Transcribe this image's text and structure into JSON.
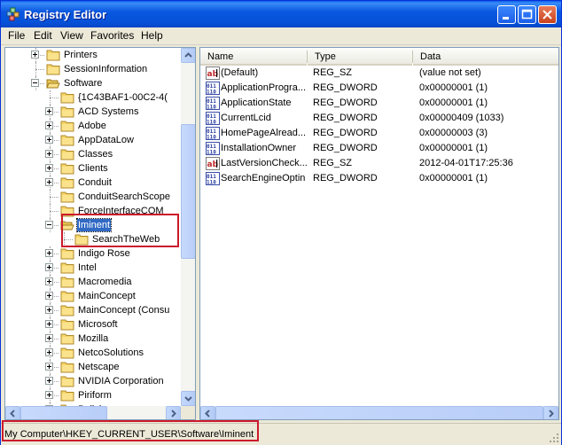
{
  "window": {
    "title": "Registry Editor"
  },
  "menu": [
    "File",
    "Edit",
    "View",
    "Favorites",
    "Help"
  ],
  "tree": {
    "items": [
      {
        "label": "Printers",
        "level": 3,
        "expander": "plus"
      },
      {
        "label": "SessionInformation",
        "level": 3,
        "expander": "none"
      },
      {
        "label": "Software",
        "level": 3,
        "expander": "minus",
        "open": true
      },
      {
        "label": "{1C43BAF1-00C2-4(",
        "level": 4,
        "expander": "none"
      },
      {
        "label": "ACD Systems",
        "level": 4,
        "expander": "plus"
      },
      {
        "label": "Adobe",
        "level": 4,
        "expander": "plus"
      },
      {
        "label": "AppDataLow",
        "level": 4,
        "expander": "plus"
      },
      {
        "label": "Classes",
        "level": 4,
        "expander": "plus"
      },
      {
        "label": "Clients",
        "level": 4,
        "expander": "plus"
      },
      {
        "label": "Conduit",
        "level": 4,
        "expander": "plus"
      },
      {
        "label": "ConduitSearchScope",
        "level": 4,
        "expander": "none"
      },
      {
        "label": "ForceInterfaceCOM",
        "level": 4,
        "expander": "none"
      },
      {
        "label": "Iminent",
        "level": 4,
        "expander": "minus",
        "open": true,
        "selected": true
      },
      {
        "label": "SearchTheWeb",
        "level": 5,
        "expander": "none"
      },
      {
        "label": "Indigo Rose",
        "level": 4,
        "expander": "plus"
      },
      {
        "label": "Intel",
        "level": 4,
        "expander": "plus"
      },
      {
        "label": "Macromedia",
        "level": 4,
        "expander": "plus"
      },
      {
        "label": "MainConcept",
        "level": 4,
        "expander": "plus"
      },
      {
        "label": "MainConcept (Consu",
        "level": 4,
        "expander": "plus"
      },
      {
        "label": "Microsoft",
        "level": 4,
        "expander": "plus"
      },
      {
        "label": "Mozilla",
        "level": 4,
        "expander": "plus"
      },
      {
        "label": "NetcoSolutions",
        "level": 4,
        "expander": "plus"
      },
      {
        "label": "Netscape",
        "level": 4,
        "expander": "plus"
      },
      {
        "label": "NVIDIA Corporation",
        "level": 4,
        "expander": "plus"
      },
      {
        "label": "Piriform",
        "level": 4,
        "expander": "plus"
      },
      {
        "label": "Policies",
        "level": 4,
        "expander": "plus"
      }
    ]
  },
  "list": {
    "columns": [
      "Name",
      "Type",
      "Data"
    ],
    "rows": [
      {
        "icon": "string-value-icon",
        "name": "(Default)",
        "type": "REG_SZ",
        "data": "(value not set)"
      },
      {
        "icon": "binary-value-icon",
        "name": "ApplicationProgra...",
        "type": "REG_DWORD",
        "data": "0x00000001 (1)"
      },
      {
        "icon": "binary-value-icon",
        "name": "ApplicationState",
        "type": "REG_DWORD",
        "data": "0x00000001 (1)"
      },
      {
        "icon": "binary-value-icon",
        "name": "CurrentLcid",
        "type": "REG_DWORD",
        "data": "0x00000409 (1033)"
      },
      {
        "icon": "binary-value-icon",
        "name": "HomePageAlread...",
        "type": "REG_DWORD",
        "data": "0x00000003 (3)"
      },
      {
        "icon": "binary-value-icon",
        "name": "InstallationOwner",
        "type": "REG_DWORD",
        "data": "0x00000001 (1)"
      },
      {
        "icon": "string-value-icon",
        "name": "LastVersionCheck...",
        "type": "REG_SZ",
        "data": "2012-04-01T17:25:36"
      },
      {
        "icon": "binary-value-icon",
        "name": "SearchEngineOptin",
        "type": "REG_DWORD",
        "data": "0x00000001 (1)"
      }
    ]
  },
  "status": {
    "path": "My Computer\\HKEY_CURRENT_USER\\Software\\Iminent"
  },
  "colors": {
    "highlight": "#cc1a2b",
    "selection": "#316ac5",
    "titlebar": "#0a58e0"
  }
}
